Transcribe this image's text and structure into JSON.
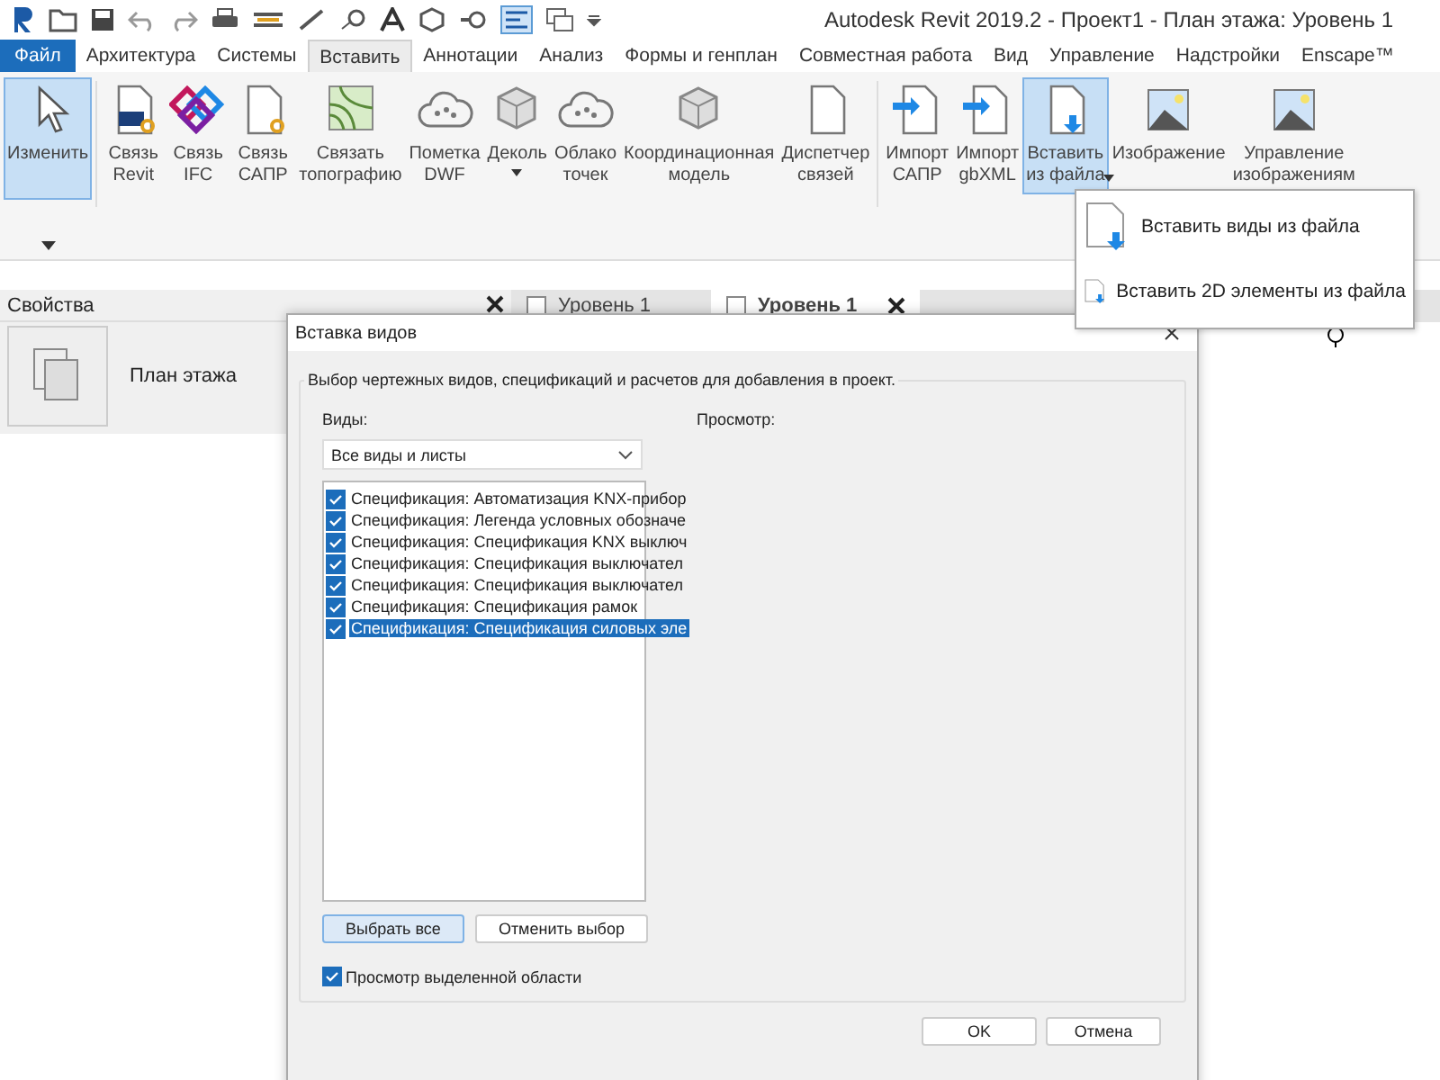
{
  "window": {
    "title": "Autodesk Revit 2019.2 - Проект1 - План этажа: Уровень 1"
  },
  "tabs": [
    {
      "label": "Файл",
      "kind": "file",
      "selected": false
    },
    {
      "label": "Архитектура",
      "kind": "tab",
      "selected": false
    },
    {
      "label": "Системы",
      "kind": "tab",
      "selected": false
    },
    {
      "label": "Вставить",
      "kind": "tab",
      "selected": true
    },
    {
      "label": "Аннотации",
      "kind": "tab",
      "selected": false
    },
    {
      "label": "Анализ",
      "kind": "tab",
      "selected": false
    },
    {
      "label": "Формы и генплан",
      "kind": "tab",
      "selected": false
    },
    {
      "label": "Совместная работа",
      "kind": "tab",
      "selected": false
    },
    {
      "label": "Вид",
      "kind": "tab",
      "selected": false
    },
    {
      "label": "Управление",
      "kind": "tab",
      "selected": false
    },
    {
      "label": "Надстройки",
      "kind": "tab",
      "selected": false
    },
    {
      "label": "Enscape™",
      "kind": "tab",
      "selected": false
    }
  ],
  "ribbon": [
    {
      "lines": [
        "Изменить"
      ],
      "selected": true,
      "dropdown": false
    },
    {
      "lines": [
        "Связь",
        "Revit"
      ],
      "selected": false,
      "dropdown": false
    },
    {
      "lines": [
        "Связь",
        "IFC"
      ],
      "selected": false,
      "dropdown": false
    },
    {
      "lines": [
        "Связь",
        "САПР"
      ],
      "selected": false,
      "dropdown": false
    },
    {
      "lines": [
        "Связать",
        "топографию"
      ],
      "selected": false,
      "dropdown": false
    },
    {
      "lines": [
        "Пометка",
        "DWF"
      ],
      "selected": false,
      "dropdown": false
    },
    {
      "lines": [
        "Деколь"
      ],
      "selected": false,
      "dropdown": true
    },
    {
      "lines": [
        "Облако",
        "точек"
      ],
      "selected": false,
      "dropdown": false
    },
    {
      "lines": [
        "Координационная",
        "модель"
      ],
      "selected": false,
      "dropdown": false
    },
    {
      "lines": [
        "Диспетчер",
        "связей"
      ],
      "selected": false,
      "dropdown": false
    },
    {
      "lines": [
        "Импорт",
        "САПР"
      ],
      "selected": false,
      "dropdown": false
    },
    {
      "lines": [
        "Импорт",
        "gbXML"
      ],
      "selected": false,
      "dropdown": false
    },
    {
      "lines": [
        "Вставить",
        "из файла"
      ],
      "selected": true,
      "dropdown": true
    },
    {
      "lines": [
        "Изображение"
      ],
      "selected": false,
      "dropdown": false
    },
    {
      "lines": [
        "Управление",
        "изображениям"
      ],
      "selected": false,
      "dropdown": false
    }
  ],
  "menu": [
    {
      "label": "Вставить виды из файла"
    },
    {
      "label": "Вставить 2D элементы из файла"
    }
  ],
  "properties": {
    "title": "Свойства",
    "type": "План этажа"
  },
  "view_tabs": [
    {
      "label": "Уровень 1",
      "selected": false
    },
    {
      "label": "Уровень 1",
      "selected": true
    }
  ],
  "dialog": {
    "title": "Вставка видов",
    "group": "Выбор чертежных видов, спецификаций и расчетов для добавления в проект.",
    "views_label": "Виды:",
    "filter": "Все виды и листы",
    "preview_label": "Просмотр:",
    "items": [
      {
        "label": "Спецификация: Автоматизация KNX-прибор",
        "checked": true,
        "selected": false
      },
      {
        "label": "Спецификация: Легенда условных обозначе",
        "checked": true,
        "selected": false
      },
      {
        "label": "Спецификация: Спецификация KNX выключ",
        "checked": true,
        "selected": false
      },
      {
        "label": "Спецификация: Спецификация выключател",
        "checked": true,
        "selected": false
      },
      {
        "label": "Спецификация: Спецификация выключател",
        "checked": true,
        "selected": false
      },
      {
        "label": "Спецификация: Спецификация рамок",
        "checked": true,
        "selected": false
      },
      {
        "label": "Спецификация: Спецификация силовых эле",
        "checked": true,
        "selected": true
      }
    ],
    "select_all": "Выбрать все",
    "deselect": "Отменить выбор",
    "preview_check": {
      "label": "Просмотр выделенной области",
      "checked": true
    },
    "ok": "OK",
    "cancel": "Отмена"
  }
}
